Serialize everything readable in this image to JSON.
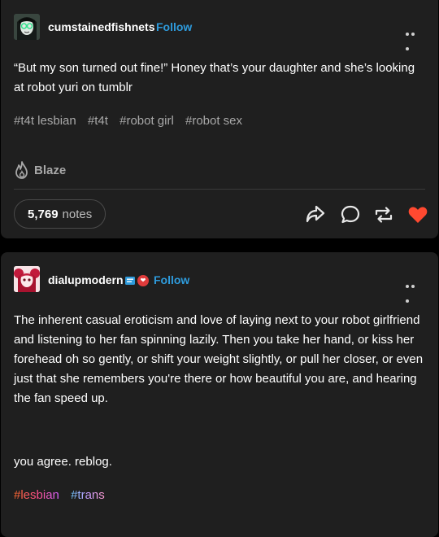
{
  "post1": {
    "username": "cumstainedfishnets",
    "follow_label": "Follow",
    "text": "“But my son turned out fine!” Honey that’s your daughter and she’s looking at robot yuri on tumblr",
    "tags": [
      "#t4t lesbian",
      "#t4t",
      "#robot girl",
      "#robot sex"
    ],
    "blaze_label": "Blaze",
    "notes_count": "5,769",
    "notes_label": "notes"
  },
  "post2": {
    "username": "dialupmodern",
    "follow_label": "Follow",
    "text": "The inherent casual eroticism and love of laying next to your robot girlfriend and listening to her fan spinning lazily. Then you take her hand, or kiss her forehead oh so gently, or shift your weight slightly, or pull her closer, or even just that she remembers you're there or how beautiful you are, and hearing the fan speed up.",
    "text2": "you agree. reblog.",
    "tags": [
      "#lesbian",
      "#trans"
    ],
    "badge_text": "❤"
  },
  "colors": {
    "accent_blue": "#2e9bdc",
    "like_red": "#ff4930",
    "tag_gray": "#a8a8a8"
  },
  "icons": [
    "more-dots-icon",
    "flame-icon",
    "share-icon",
    "reply-icon",
    "reblog-icon",
    "heart-icon"
  ]
}
